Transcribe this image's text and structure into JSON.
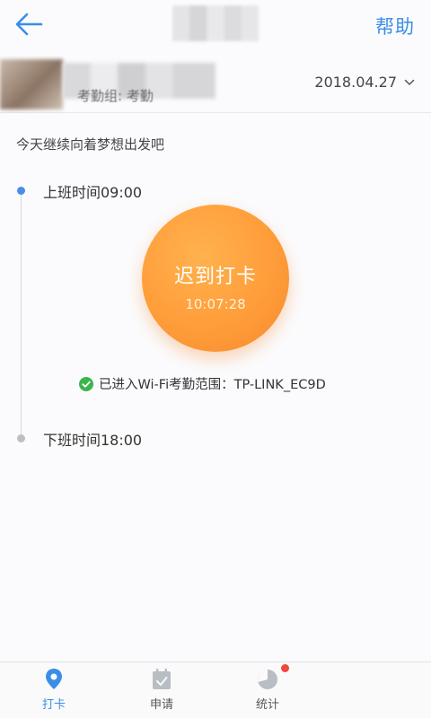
{
  "header": {
    "help_label": "帮助",
    "back_icon": "back-arrow-icon"
  },
  "user": {
    "group_label": "考勤组: 考勤"
  },
  "date_select": {
    "value": "2018.04.27"
  },
  "motto": "今天继续向着梦想出发吧",
  "timeline": {
    "on_duty_label": "上班时间09:00",
    "off_duty_label": "下班时间18:00"
  },
  "punch": {
    "label": "迟到打卡",
    "time": "10:07:28"
  },
  "wifi": {
    "status_text": "已进入Wi-Fi考勤范围：TP-LINK_EC9D"
  },
  "nav": {
    "items": [
      {
        "label": "打卡",
        "icon": "location-pin-icon",
        "active": true
      },
      {
        "label": "申请",
        "icon": "calendar-check-icon",
        "active": false
      },
      {
        "label": "统计",
        "icon": "pie-chart-icon",
        "active": false,
        "badge": true
      }
    ]
  },
  "colors": {
    "accent": "#3a8ee6",
    "punch": "#ff9d3a",
    "success": "#3cb54a",
    "badge": "#f2473f"
  }
}
